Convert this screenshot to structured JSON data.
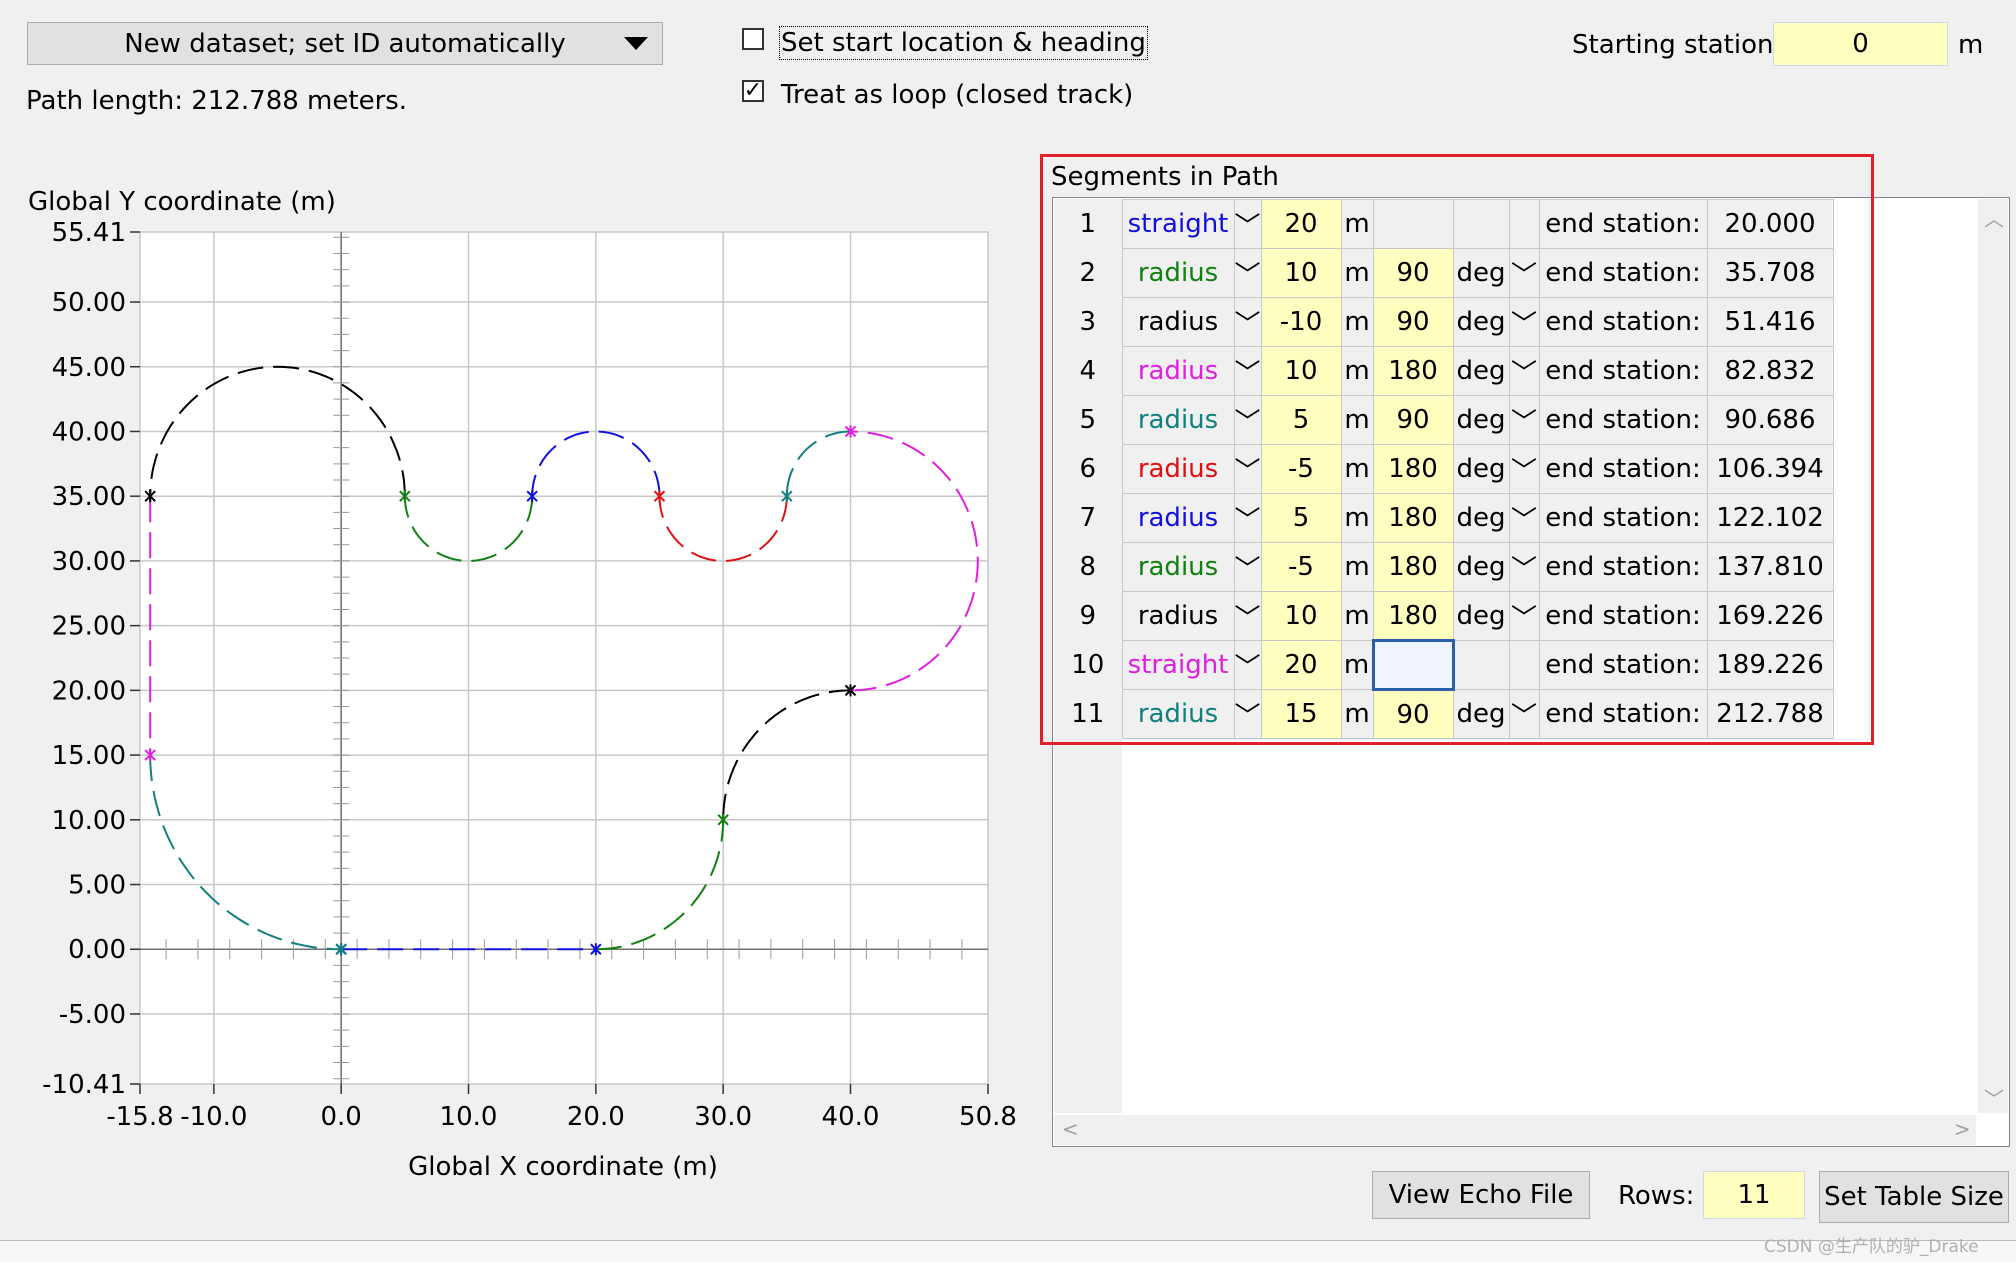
{
  "dataset": {
    "selected": "New dataset; set ID automatically"
  },
  "path_length": "Path length: 212.788 meters.",
  "options": {
    "start_location_label": "Set start location & heading",
    "start_location_checked": false,
    "loop_label": "Treat as loop (closed track)",
    "loop_checked": true
  },
  "starting_station": {
    "label": "Starting station:",
    "value": "0",
    "unit": "m"
  },
  "segments_title": "Segments in Path",
  "chart_data": {
    "type": "line",
    "ylabel": "Global Y coordinate (m)",
    "xlabel": "Global X coordinate (m)",
    "xlim": [
      -15.8,
      50.8
    ],
    "ylim": [
      -10.41,
      55.41
    ],
    "x_ticks": [
      "-15.8",
      "-10.0",
      "0.0",
      "10.0",
      "20.0",
      "30.0",
      "40.0",
      "50.8"
    ],
    "y_ticks": [
      "55.41",
      "50.00",
      "45.00",
      "40.00",
      "35.00",
      "30.00",
      "25.00",
      "20.00",
      "15.00",
      "10.00",
      "5.00",
      "0.00",
      "-5.00",
      "-10.41"
    ],
    "grid": true,
    "segments": [
      {
        "kind": "straight",
        "color": "#1010e0",
        "start": [
          0,
          0
        ],
        "heading": 0,
        "length": 20
      },
      {
        "kind": "arc",
        "color": "#108010",
        "radius": 10,
        "angle": 90
      },
      {
        "kind": "arc",
        "color": "#000000",
        "radius": -10,
        "angle": 90
      },
      {
        "kind": "arc",
        "color": "#e020e0",
        "radius": 10,
        "angle": 180
      },
      {
        "kind": "arc",
        "color": "#108080",
        "radius": 5,
        "angle": 90
      },
      {
        "kind": "arc",
        "color": "#e01010",
        "radius": -5,
        "angle": 180
      },
      {
        "kind": "arc",
        "color": "#1010e0",
        "radius": 5,
        "angle": 180
      },
      {
        "kind": "arc",
        "color": "#108010",
        "radius": -5,
        "angle": 180
      },
      {
        "kind": "arc",
        "color": "#000000",
        "radius": 10,
        "angle": 180
      },
      {
        "kind": "straight",
        "color": "#e020e0",
        "length": 20
      },
      {
        "kind": "arc",
        "color": "#108080",
        "radius": 15,
        "angle": 90
      }
    ]
  },
  "table": {
    "end_label": "end station:",
    "rows": [
      {
        "n": "1",
        "type": "straight",
        "color": "#1010e0",
        "v1": "20",
        "u1": "m",
        "v2": "",
        "u2": "",
        "has_deg": false,
        "end": "20.000"
      },
      {
        "n": "2",
        "type": "radius",
        "color": "#108010",
        "v1": "10",
        "u1": "m",
        "v2": "90",
        "u2": "deg",
        "has_deg": true,
        "end": "35.708"
      },
      {
        "n": "3",
        "type": "radius",
        "color": "#000000",
        "v1": "-10",
        "u1": "m",
        "v2": "90",
        "u2": "deg",
        "has_deg": true,
        "end": "51.416"
      },
      {
        "n": "4",
        "type": "radius",
        "color": "#e020e0",
        "v1": "10",
        "u1": "m",
        "v2": "180",
        "u2": "deg",
        "has_deg": true,
        "end": "82.832"
      },
      {
        "n": "5",
        "type": "radius",
        "color": "#108080",
        "v1": "5",
        "u1": "m",
        "v2": "90",
        "u2": "deg",
        "has_deg": true,
        "end": "90.686"
      },
      {
        "n": "6",
        "type": "radius",
        "color": "#e01010",
        "v1": "-5",
        "u1": "m",
        "v2": "180",
        "u2": "deg",
        "has_deg": true,
        "end": "106.394"
      },
      {
        "n": "7",
        "type": "radius",
        "color": "#1010e0",
        "v1": "5",
        "u1": "m",
        "v2": "180",
        "u2": "deg",
        "has_deg": true,
        "end": "122.102"
      },
      {
        "n": "8",
        "type": "radius",
        "color": "#108010",
        "v1": "-5",
        "u1": "m",
        "v2": "180",
        "u2": "deg",
        "has_deg": true,
        "end": "137.810"
      },
      {
        "n": "9",
        "type": "radius",
        "color": "#000000",
        "v1": "10",
        "u1": "m",
        "v2": "180",
        "u2": "deg",
        "has_deg": true,
        "end": "169.226"
      },
      {
        "n": "10",
        "type": "straight",
        "color": "#e020e0",
        "v1": "20",
        "u1": "m",
        "v2": "",
        "u2": "",
        "has_deg": false,
        "end": "189.226",
        "selected": true
      },
      {
        "n": "11",
        "type": "radius",
        "color": "#108080",
        "v1": "15",
        "u1": "m",
        "v2": "90",
        "u2": "deg",
        "has_deg": true,
        "end": "212.788"
      }
    ]
  },
  "buttons": {
    "view_echo": "View Echo File",
    "set_table_size": "Set Table Size"
  },
  "rows_field": {
    "label": "Rows:",
    "value": "11"
  },
  "watermark": "CSDN @生产队的驴_Drake"
}
